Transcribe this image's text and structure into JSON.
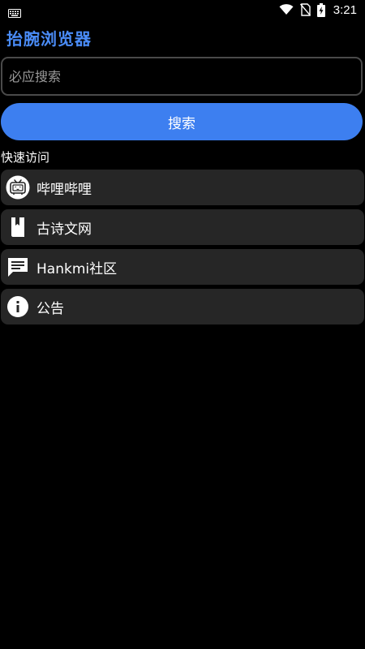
{
  "status_bar": {
    "time": "3:21",
    "icons": [
      "keyboard-icon",
      "wifi-icon",
      "no-sim-icon",
      "battery-charging-icon"
    ]
  },
  "app": {
    "title": "抬腕浏览器"
  },
  "search": {
    "placeholder": "必应搜索",
    "value": "",
    "button_label": "搜索"
  },
  "quick_access": {
    "label": "快速访问",
    "items": [
      {
        "label": "哔哩哔哩",
        "icon": "tv-icon"
      },
      {
        "label": "古诗文网",
        "icon": "book-icon"
      },
      {
        "label": "Hankmi社区",
        "icon": "message-icon"
      },
      {
        "label": "公告",
        "icon": "info-icon"
      }
    ]
  },
  "colors": {
    "background": "#000000",
    "accent": "#3d7ff0",
    "title": "#4a8cf7",
    "item_bg": "#262626",
    "input_border": "#4a4a4a",
    "placeholder": "#9a9a9a"
  }
}
